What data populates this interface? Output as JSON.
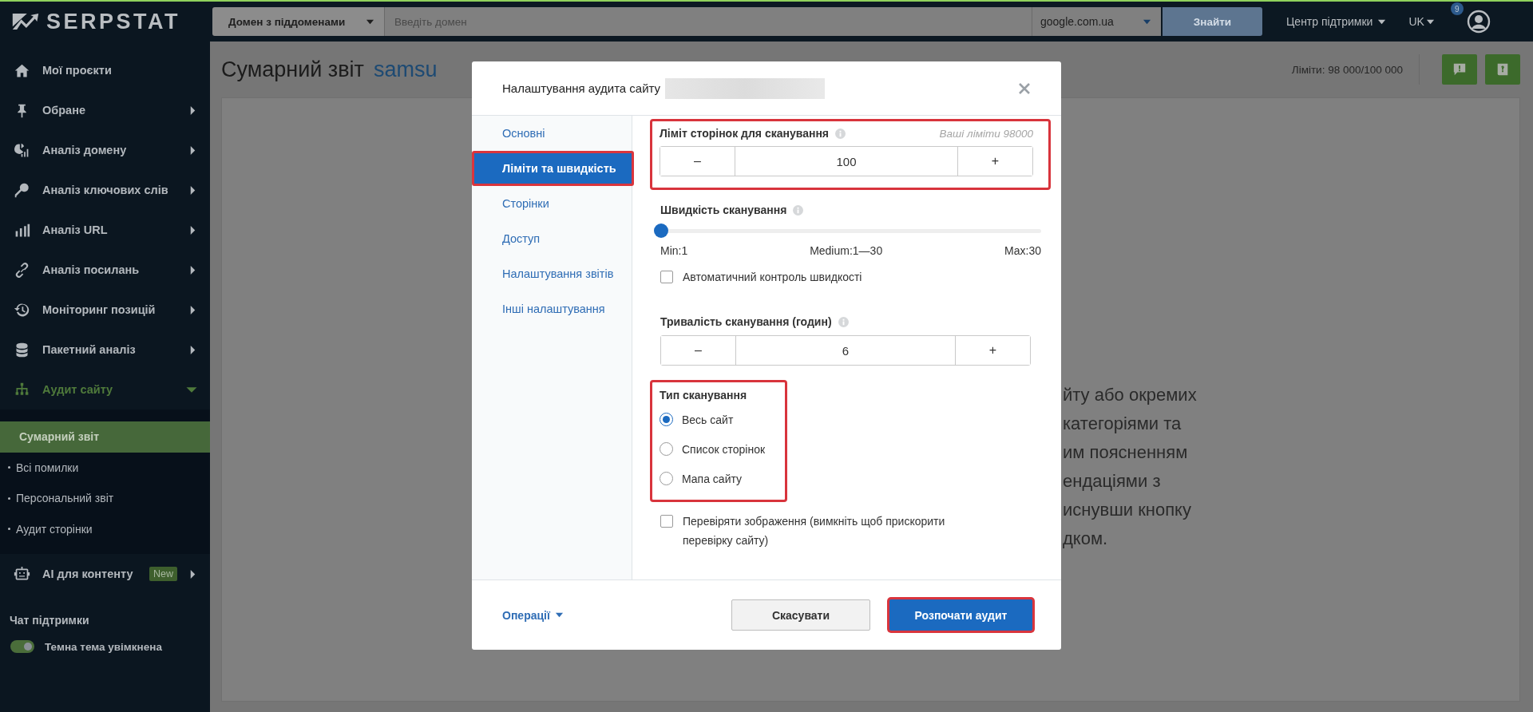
{
  "logo": {
    "text": "SERPSTAT"
  },
  "sidebar": {
    "items": [
      {
        "label": "Мої проєкти",
        "active": false
      },
      {
        "label": "Обране",
        "active": false,
        "expanded": false
      },
      {
        "label": "Аналіз домену",
        "active": false,
        "expanded": false
      },
      {
        "label": "Аналіз ключових слів",
        "active": false,
        "expanded": false
      },
      {
        "label": "Аналіз URL",
        "active": false,
        "expanded": false
      },
      {
        "label": "Аналіз посилань",
        "active": false,
        "expanded": false
      },
      {
        "label": "Моніторинг позицій",
        "active": false,
        "expanded": false
      },
      {
        "label": "Пакетний аналіз",
        "active": false,
        "expanded": false
      },
      {
        "label": "Аудит сайту",
        "active": true,
        "expanded": true,
        "children": [
          {
            "label": "Сумарний звіт",
            "selected": true
          },
          {
            "label": "Всі помилки",
            "selected": false
          },
          {
            "label": "Персональний звіт",
            "selected": false
          },
          {
            "label": "Аудит сторінки",
            "selected": false
          }
        ]
      },
      {
        "label": "AI для контенту",
        "active": false,
        "expanded": false,
        "badge": "New"
      }
    ],
    "support_chat": "Чат підтримки",
    "theme_toggle": {
      "label": "Темна тема увімкнена",
      "on": true
    }
  },
  "topbar": {
    "scope_select": "Домен з піддоменами",
    "domain_input": {
      "placeholder": "Введіть домен"
    },
    "engine_select": "google.com.ua",
    "search_button": "Знайти",
    "support_menu": "Центр підтримки",
    "language": "UK",
    "notifications_badge": "9"
  },
  "page": {
    "title": "Сумарний звіт",
    "domain": "samsu",
    "limits": "Ліміти: 98 000/100 000",
    "description_lines": [
      "йту або окремих",
      "категоріями та",
      "им поясненням",
      "ендаціями з",
      "иснувши кнопку",
      "дком."
    ]
  },
  "modal": {
    "title": "Налаштування аудита сайту",
    "nav": [
      {
        "label": "Основні",
        "selected": false,
        "highlighted": false
      },
      {
        "label": "Ліміти та швидкість",
        "selected": true,
        "highlighted": true
      },
      {
        "label": "Сторінки",
        "selected": false,
        "highlighted": false
      },
      {
        "label": "Доступ",
        "selected": false,
        "highlighted": false
      },
      {
        "label": "Налаштування звітів",
        "selected": false,
        "highlighted": false
      },
      {
        "label": "Інші налаштування",
        "selected": false,
        "highlighted": false
      }
    ],
    "page_limit": {
      "label": "Ліміт сторінок для сканування",
      "hint": "Ваші ліміти 98000",
      "minus": "–",
      "value": "100",
      "plus": "+",
      "highlighted": true
    },
    "speed": {
      "label": "Швидкість сканування",
      "level": 0,
      "min_label": "Min:1",
      "medium_label": "Medium:1—30",
      "max_label": "Max:30"
    },
    "auto_speed": {
      "label": "Автоматичний контроль швидкості",
      "checked": false
    },
    "duration": {
      "label": "Тривалість сканування (годин)",
      "minus": "–",
      "value": "6",
      "plus": "+"
    },
    "scan_type": {
      "label": "Тип сканування",
      "highlighted": true,
      "options": [
        {
          "label": "Весь сайт",
          "selected": true
        },
        {
          "label": "Список сторінок",
          "selected": false
        },
        {
          "label": "Мапа сайту",
          "selected": false
        }
      ]
    },
    "check_images": {
      "label": "Перевіряти зображення (вимкніть щоб прискорити перевірку сайту)",
      "checked": false
    },
    "operations": "Операції",
    "cancel_button": "Скасувати",
    "start_button": {
      "label": "Розпочати аудит",
      "highlighted": true
    }
  }
}
